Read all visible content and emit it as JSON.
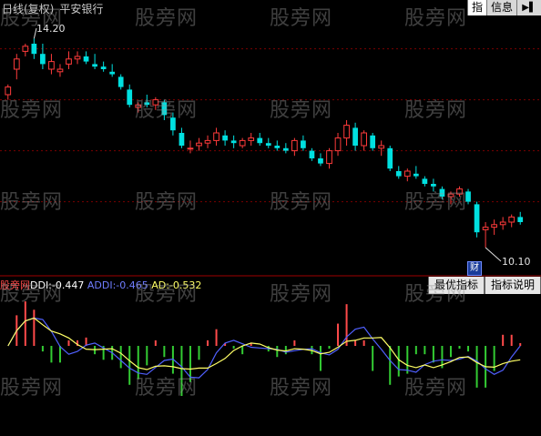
{
  "header": {
    "period": "日线(复权)",
    "stock": "平安银行",
    "tabs": [
      "指",
      "信息"
    ],
    "collapse_icon": "arrow-right-icon"
  },
  "price_chart": {
    "high_label": "14.20",
    "low_label": "10.10",
    "finance_badge": "财",
    "grid_levels": [
      14.0,
      13.0,
      12.0,
      11.0
    ],
    "ylim": [
      9.6,
      14.6
    ]
  },
  "indicator": {
    "source": "股旁网",
    "ddi_label": "DDI:",
    "ddi_value": "-0.447",
    "addi_label": "ADDI:",
    "addi_value": "-0.465",
    "ad_label": "AD:",
    "ad_value": "-0.532",
    "buttons": [
      "最优指标",
      "指标说明"
    ],
    "colors": {
      "ddi": "#ffffff",
      "addi": "#5060ff",
      "ad": "#ffff66",
      "pos_bar": "#ff4a4a",
      "neg_bar": "#33cc33"
    }
  },
  "watermark": "股旁网",
  "colors": {
    "up": "#ff3b3b",
    "down": "#00e0e0",
    "grid": "#7a0000"
  },
  "chart_data": [
    {
      "type": "candlestick",
      "title": "平安银行 日线(复权)",
      "annotations": [
        "14.20",
        "10.10"
      ],
      "candles": [
        [
          13.1,
          13.3,
          13.0,
          13.25
        ],
        [
          13.6,
          13.9,
          13.4,
          13.8
        ],
        [
          13.95,
          14.1,
          13.85,
          14.05
        ],
        [
          14.1,
          14.2,
          13.8,
          13.9
        ],
        [
          13.9,
          14.1,
          13.6,
          13.7
        ],
        [
          13.6,
          13.9,
          13.5,
          13.75
        ],
        [
          13.55,
          13.7,
          13.45,
          13.6
        ],
        [
          13.7,
          13.95,
          13.6,
          13.8
        ],
        [
          13.8,
          13.95,
          13.7,
          13.85
        ],
        [
          13.85,
          13.95,
          13.7,
          13.75
        ],
        [
          13.7,
          13.9,
          13.6,
          13.65
        ],
        [
          13.65,
          13.75,
          13.55,
          13.6
        ],
        [
          13.55,
          13.7,
          13.45,
          13.5
        ],
        [
          13.45,
          13.5,
          13.2,
          13.25
        ],
        [
          13.2,
          13.3,
          12.85,
          12.9
        ],
        [
          12.85,
          12.95,
          12.75,
          12.9
        ],
        [
          12.95,
          13.1,
          12.85,
          12.9
        ],
        [
          12.9,
          13.05,
          12.8,
          13.0
        ],
        [
          12.95,
          13.0,
          12.6,
          12.7
        ],
        [
          12.65,
          12.75,
          12.3,
          12.4
        ],
        [
          12.35,
          12.45,
          12.05,
          12.1
        ],
        [
          12.05,
          12.2,
          11.95,
          12.05
        ],
        [
          12.1,
          12.25,
          12.0,
          12.15
        ],
        [
          12.15,
          12.3,
          12.05,
          12.2
        ],
        [
          12.2,
          12.45,
          12.1,
          12.35
        ],
        [
          12.3,
          12.4,
          12.1,
          12.2
        ],
        [
          12.2,
          12.3,
          12.05,
          12.15
        ],
        [
          12.1,
          12.25,
          12.05,
          12.2
        ],
        [
          12.2,
          12.35,
          12.1,
          12.25
        ],
        [
          12.25,
          12.35,
          12.1,
          12.15
        ],
        [
          12.15,
          12.25,
          12.05,
          12.1
        ],
        [
          12.1,
          12.2,
          12.0,
          12.05
        ],
        [
          12.05,
          12.15,
          11.95,
          12.0
        ],
        [
          12.0,
          12.25,
          11.9,
          12.2
        ],
        [
          12.2,
          12.3,
          12.0,
          12.05
        ],
        [
          12.0,
          12.05,
          11.8,
          11.85
        ],
        [
          11.85,
          11.95,
          11.7,
          11.75
        ],
        [
          11.75,
          12.05,
          11.65,
          12.0
        ],
        [
          12.0,
          12.35,
          11.9,
          12.25
        ],
        [
          12.25,
          12.6,
          12.1,
          12.5
        ],
        [
          12.45,
          12.55,
          12.0,
          12.1
        ],
        [
          12.1,
          12.4,
          12.0,
          12.35
        ],
        [
          12.3,
          12.35,
          12.0,
          12.05
        ],
        [
          12.05,
          12.2,
          11.9,
          12.1
        ],
        [
          12.05,
          12.1,
          11.6,
          11.65
        ],
        [
          11.6,
          11.7,
          11.45,
          11.5
        ],
        [
          11.5,
          11.65,
          11.4,
          11.6
        ],
        [
          11.55,
          11.7,
          11.45,
          11.5
        ],
        [
          11.45,
          11.5,
          11.3,
          11.35
        ],
        [
          11.35,
          11.45,
          11.2,
          11.3
        ],
        [
          11.25,
          11.3,
          11.05,
          11.1
        ],
        [
          11.1,
          11.2,
          10.95,
          11.15
        ],
        [
          11.15,
          11.3,
          11.1,
          11.25
        ],
        [
          11.2,
          11.25,
          10.95,
          11.0
        ],
        [
          10.95,
          11.0,
          10.3,
          10.4
        ],
        [
          10.45,
          10.6,
          10.1,
          10.5
        ],
        [
          10.5,
          10.65,
          10.35,
          10.55
        ],
        [
          10.55,
          10.7,
          10.45,
          10.6
        ],
        [
          10.6,
          10.75,
          10.5,
          10.7
        ],
        [
          10.7,
          10.8,
          10.55,
          10.6
        ]
      ]
    },
    {
      "type": "line",
      "title": "DDI",
      "series": [
        {
          "name": "DDI",
          "values": [
            -0.447
          ]
        },
        {
          "name": "ADDI",
          "values": [
            -0.465
          ]
        },
        {
          "name": "AD",
          "values": [
            -0.532
          ]
        }
      ]
    }
  ]
}
